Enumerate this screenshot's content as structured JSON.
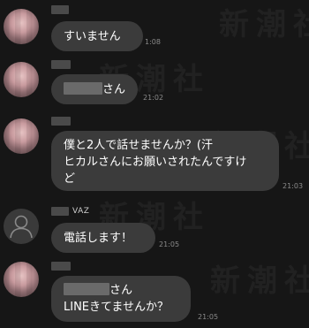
{
  "watermark": "新潮社",
  "messages": [
    {
      "text": "すいません",
      "time": "1:08"
    },
    {
      "text_suffix": "さん",
      "time": "21:02"
    },
    {
      "line1": "僕と2人で話せませんか？(汗",
      "line2": "ヒカルさんにお願いされたんですけ",
      "line3": "ど",
      "time": "21:03"
    },
    {
      "sender_tag": "VAZ",
      "text": "電話します！",
      "time": "21:05"
    },
    {
      "line1_suffix": "さん",
      "line2": "LINEきてませんか？",
      "time": "21:05"
    }
  ]
}
